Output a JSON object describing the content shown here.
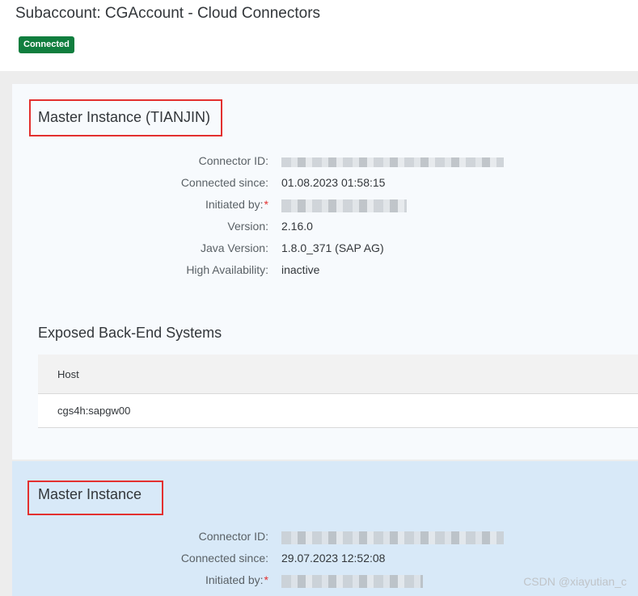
{
  "header": {
    "title": "Subaccount: CGAccount - Cloud Connectors",
    "status": "Connected"
  },
  "instances": [
    {
      "title": "Master Instance (TIANJIN)",
      "fields": {
        "connector_id_label": "Connector ID:",
        "connected_since_label": "Connected since:",
        "connected_since": "01.08.2023 01:58:15",
        "initiated_by_label": "Initiated by:",
        "version_label": "Version:",
        "version": "2.16.0",
        "java_version_label": "Java Version:",
        "java_version": "1.8.0_371 (SAP AG)",
        "ha_label": "High Availability:",
        "ha": "inactive"
      },
      "exposed_systems": {
        "title": "Exposed Back-End Systems",
        "columns": [
          "Host"
        ],
        "rows": [
          [
            "cgs4h:sapgw00"
          ]
        ]
      }
    },
    {
      "title": "Master Instance",
      "fields": {
        "connector_id_label": "Connector ID:",
        "connected_since_label": "Connected since:",
        "connected_since": "29.07.2023 12:52:08",
        "initiated_by_label": "Initiated by:"
      }
    }
  ],
  "watermark": "CSDN @xiayutian_c",
  "colors": {
    "status_green": "#107e3e",
    "highlight_red": "#e3302f",
    "required_red": "#e3302f",
    "section_light": "#f7fafd",
    "section_selected": "#d8e9f8"
  }
}
